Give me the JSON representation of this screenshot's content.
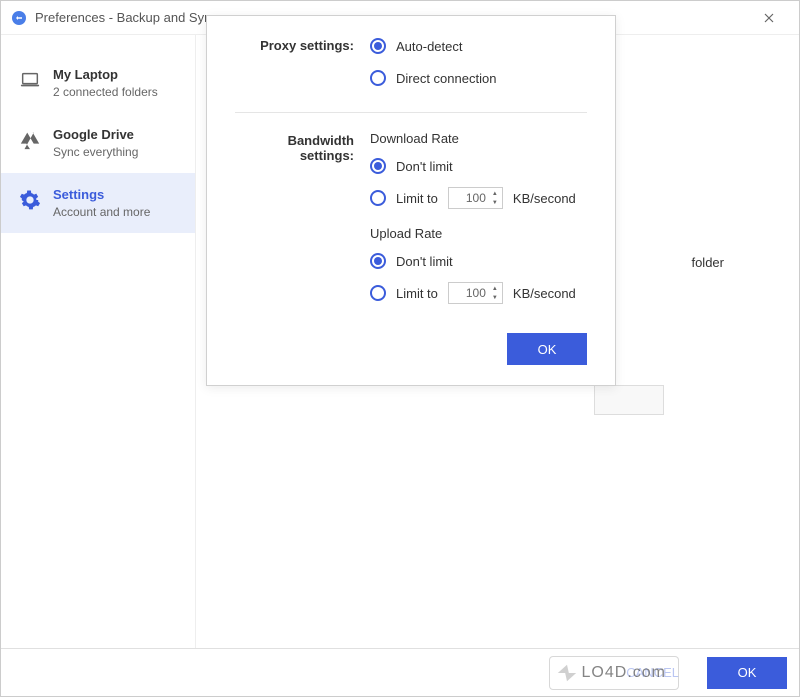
{
  "titlebar": {
    "title": "Preferences - Backup and Sync"
  },
  "sidebar": {
    "items": [
      {
        "title": "My Laptop",
        "subtitle": "2 connected folders"
      },
      {
        "title": "Google Drive",
        "subtitle": "Sync everything"
      },
      {
        "title": "Settings",
        "subtitle": "Account and more"
      }
    ]
  },
  "dialog": {
    "proxy_label": "Proxy settings:",
    "proxy_options": {
      "auto": "Auto-detect",
      "direct": "Direct connection"
    },
    "bandwidth_label": "Bandwidth settings:",
    "download_heading": "Download Rate",
    "upload_heading": "Upload Rate",
    "rate_options": {
      "dont_limit": "Don't limit",
      "limit_to": "Limit to"
    },
    "download_value": "100",
    "upload_value": "100",
    "unit": "KB/second",
    "ok_button": "OK"
  },
  "background": {
    "folder_text": "folder"
  },
  "footer": {
    "cancel": "CANCEL",
    "ok": "OK"
  },
  "watermark": "LO4D.com"
}
